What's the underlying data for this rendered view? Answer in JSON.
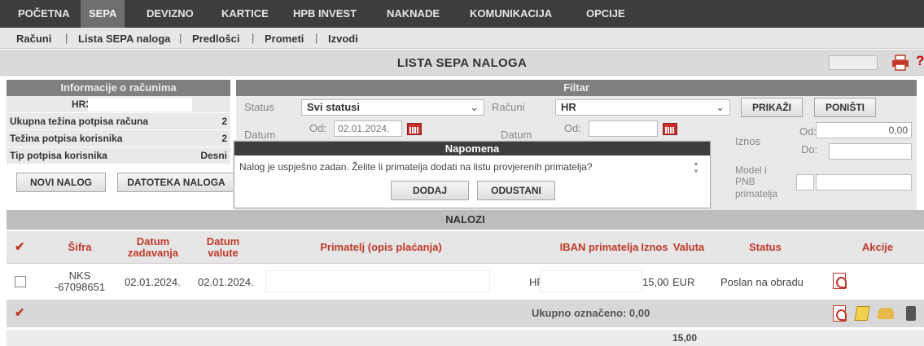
{
  "topnav": {
    "items": [
      {
        "label": "POČETNA"
      },
      {
        "label": "SEPA"
      },
      {
        "label": "DEVIZNO"
      },
      {
        "label": "KARTICE"
      },
      {
        "label": "HPB INVEST"
      },
      {
        "label": "NAKNADE"
      },
      {
        "label": "KOMUNIKACIJA"
      },
      {
        "label": "OPCIJE"
      }
    ],
    "active": "SEPA"
  },
  "subnav": {
    "items": [
      {
        "label": "Računi"
      },
      {
        "label": "Lista SEPA naloga"
      },
      {
        "label": "Predlošci"
      },
      {
        "label": "Prometi"
      },
      {
        "label": "Izvodi"
      }
    ],
    "separator": "|"
  },
  "page": {
    "title": "LISTA SEPA NALOGA",
    "help": "?"
  },
  "info": {
    "header": "Informacije o računima",
    "account_prefix": "HR3",
    "rows": [
      {
        "label": "Ukupna težina potpisa računa",
        "value": "2"
      },
      {
        "label": "Težina potpisa korisnika",
        "value": "2"
      },
      {
        "label": "Tip potpisa korisnika",
        "value": "Desni"
      }
    ],
    "new_order_label": "NOVI NALOG",
    "file_order_label": "DATOTEKA NALOGA"
  },
  "filter": {
    "header": "Filtar",
    "status_label": "Status",
    "status_value": "Svi statusi",
    "accounts_label": "Računi",
    "accounts_value": "HR",
    "show_label": "PRIKAŽI",
    "reset_label": "PONIŠTI",
    "date_label": "Datum",
    "from_label": "Od:",
    "date_from_value": "02.01.2024.",
    "date2_label": "Datum",
    "from2_label": "Od:",
    "amount_label": "Iznos",
    "amount_from_label": "Od:",
    "amount_from_value": "0,00",
    "amount_to_label": "Do:",
    "model_label_1": "Model i",
    "model_label_2": "PNB",
    "model_label_3": "primatelja"
  },
  "modal": {
    "title": "Napomena",
    "message": "Nalog je uspješno zadan. Želite li primatelja dodati na listu provjerenih primatelja?",
    "add_label": "DODAJ",
    "cancel_label": "ODUSTANI"
  },
  "orders": {
    "section_title": "NALOZI",
    "columns": {
      "code": "Šifra",
      "entry_date_1": "Datum",
      "entry_date_2": "zadavanja",
      "value_date_1": "Datum",
      "value_date_2": "valute",
      "recipient": "Primatelj (opis plaćanja)",
      "iban": "IBAN primatelja",
      "amount": "Iznos",
      "currency": "Valuta",
      "status": "Status",
      "actions": "Akcije"
    },
    "rows": [
      {
        "code_1": "NKS",
        "code_2": "-67098651",
        "entry_date": "02.01.2024.",
        "value_date": "02.01.2024.",
        "iban_prefix": "HR",
        "amount": "15,00",
        "currency": "EUR",
        "status": "Poslan na obradu"
      }
    ],
    "selected_total_label": "Ukupno označeno: 0,00",
    "grand_total": "15,00"
  },
  "colors": {
    "nav_bg": "#3d3d3d",
    "nav_active": "#6f6f6f",
    "accent_red": "#c0392b",
    "panel_header": "#808080",
    "panel_body": "#e9e9e9"
  }
}
